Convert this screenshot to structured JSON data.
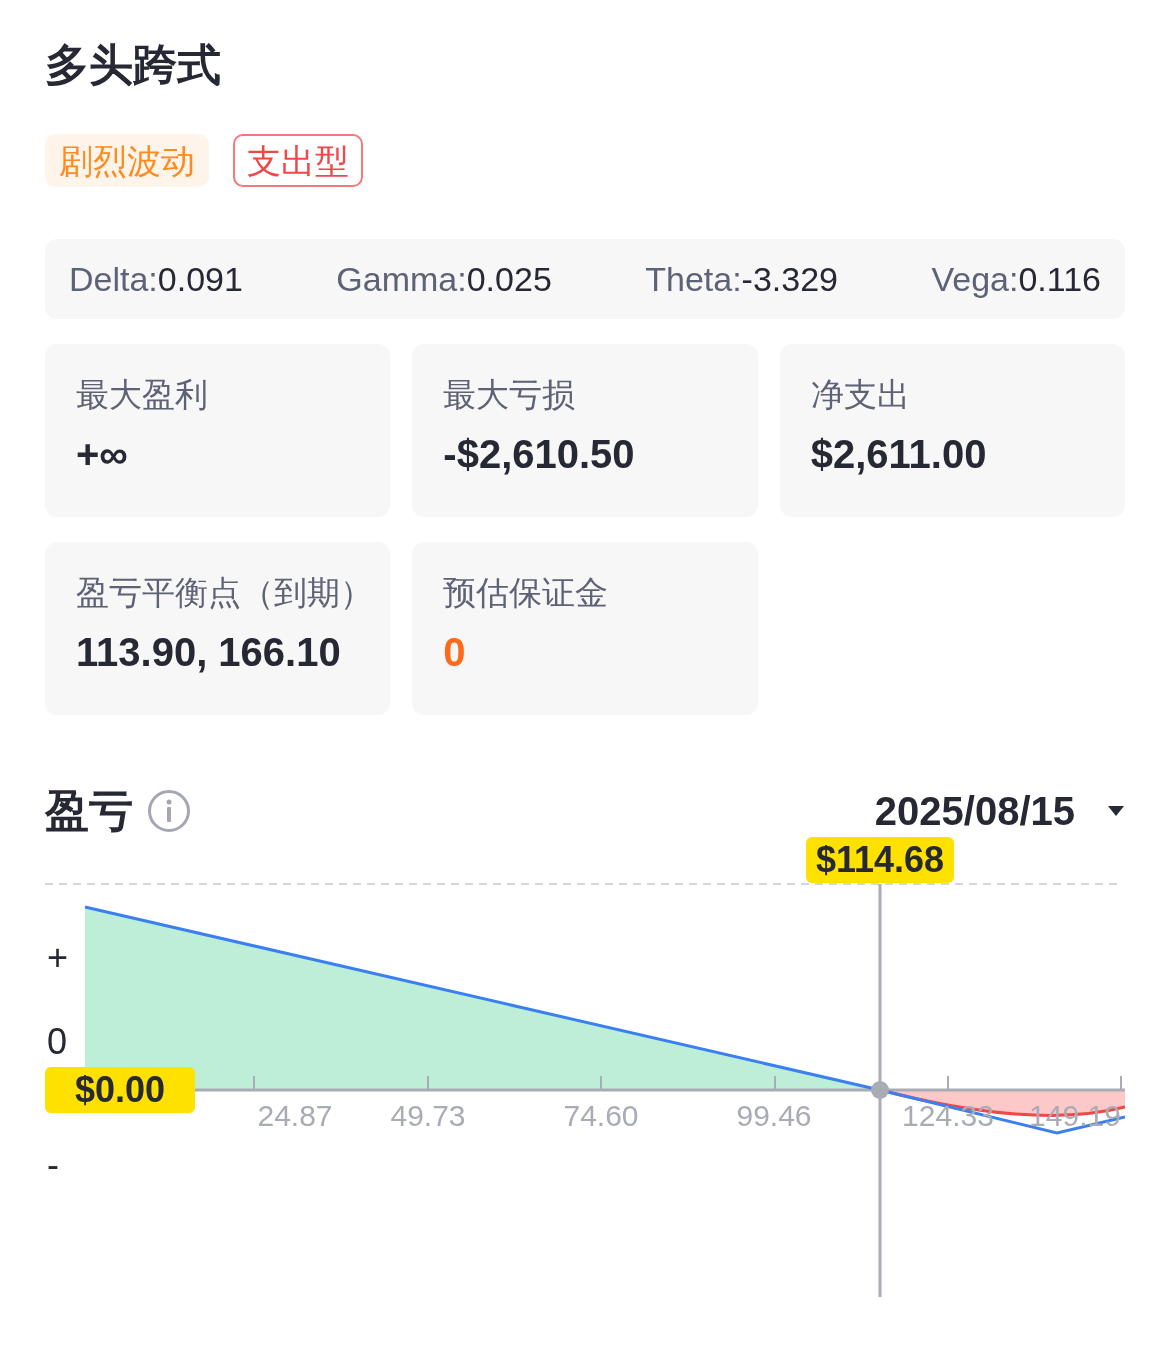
{
  "title": "多头跨式",
  "tags": [
    {
      "label": "剧烈波动",
      "kind": "filled"
    },
    {
      "label": "支出型",
      "kind": "outline"
    }
  ],
  "greeks": [
    {
      "label": "Delta:",
      "value": "0.091"
    },
    {
      "label": "Gamma:",
      "value": "0.025"
    },
    {
      "label": "Theta:",
      "value": "-3.329"
    },
    {
      "label": "Vega:",
      "value": "0.116"
    }
  ],
  "stats": [
    {
      "label": "最大盈利",
      "value": "+∞",
      "kind": "plain"
    },
    {
      "label": "最大亏损",
      "value": "-$2,610.50",
      "kind": "plain"
    },
    {
      "label": "净支出",
      "value": "$2,611.00",
      "kind": "plain"
    },
    {
      "label": "盈亏平衡点（到期）",
      "value": "113.90, 166.10",
      "kind": "plain"
    },
    {
      "label": "预估保证金",
      "value": "0",
      "kind": "accent"
    }
  ],
  "pnl": {
    "title": "盈亏",
    "date": "2025/08/15",
    "price_tag": "$114.68",
    "zero_tag": "$0.00",
    "y_labels": [
      "+",
      "0",
      "-"
    ],
    "x_labels": [
      "24.87",
      "49.73",
      "74.60",
      "99.46",
      "124.33",
      "149.19"
    ]
  }
}
